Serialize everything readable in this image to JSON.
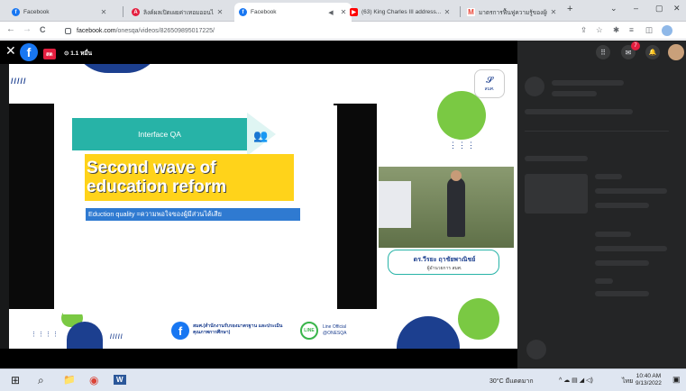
{
  "tabs": [
    {
      "label": "Facebook",
      "favicon": "facebook-icon",
      "color": "#1877f2",
      "active": false
    },
    {
      "label": "ลิงค์ผลเปิดเผยค่าเทอมออนไลน์ ว...",
      "favicon": "ads-icon",
      "color": "#e41e3f",
      "active": false
    },
    {
      "label": "Facebook",
      "favicon": "facebook-icon",
      "color": "#1877f2",
      "active": true
    },
    {
      "label": "(63) King Charles III address...",
      "favicon": "youtube-icon",
      "color": "#ff0000",
      "active": false
    },
    {
      "label": "มาตรการฟื้นฟูความรู้ของผู้เรียนเนื่...",
      "favicon": "gmail-icon",
      "color": "#ea4335",
      "active": false
    }
  ],
  "tab_extra_icon": "◀",
  "new_tab": "+",
  "window_controls": {
    "minimize": "–",
    "maximize": "▢",
    "close": "✕",
    "tabsearch": "⌄"
  },
  "toolbar": {
    "back": "←",
    "forward": "→",
    "reload": "C",
    "url_host": "facebook.com",
    "url_path": "/onesqa/videos/826509895017225/"
  },
  "toolbar_icons": {
    "share": "⇪",
    "star": "☆",
    "extensions": "✱",
    "playlist": "≡",
    "sidepanel": "◫"
  },
  "video_header": {
    "close": "✕",
    "fb_logo": "f",
    "live_label": "สด",
    "viewers": "⊙ 1.1 หมื่น"
  },
  "right_header": {
    "apps": "⠿",
    "messenger": "✉",
    "notifications": "🔔",
    "badge": "7"
  },
  "slide": {
    "topic": "Interface QA",
    "headline_line1": "Second wave of",
    "headline_line2": "education reform",
    "subtitle": "Eduction quality =ความพอใจของผู้มีส่วนได้เสีย",
    "people_icon": "👥",
    "dots_left": "⋮⋮⋮⋮",
    "dots_right": "⋮⋮⋮",
    "slashes": "/////"
  },
  "logo": {
    "mark": "𝓢",
    "text": "สมศ."
  },
  "namecard": {
    "name": "ดร.วีรยะ ฤาชัยพาณิชย์",
    "title": "ผู้อำนวยการ สมศ."
  },
  "footer": {
    "fb_logo": "f",
    "fb_text": "สมศ.(สำนักงานรับรองมาตรฐาน และประเมินคุณภาพการศึกษา)",
    "line_logo": "LINE",
    "line_text": "Line Official @ONESQA"
  },
  "taskbar": {
    "windows": "⊞",
    "search": "⌕",
    "explorer": "📁",
    "chrome": "◉",
    "word": "W",
    "weather": "30°C มีแดดมาก",
    "tray_icons": "^  ☁  ▤  ◢  ◁)",
    "language": "ไทย",
    "time": "10:40 AM",
    "date": "9/13/2022",
    "notifications": "▣"
  }
}
